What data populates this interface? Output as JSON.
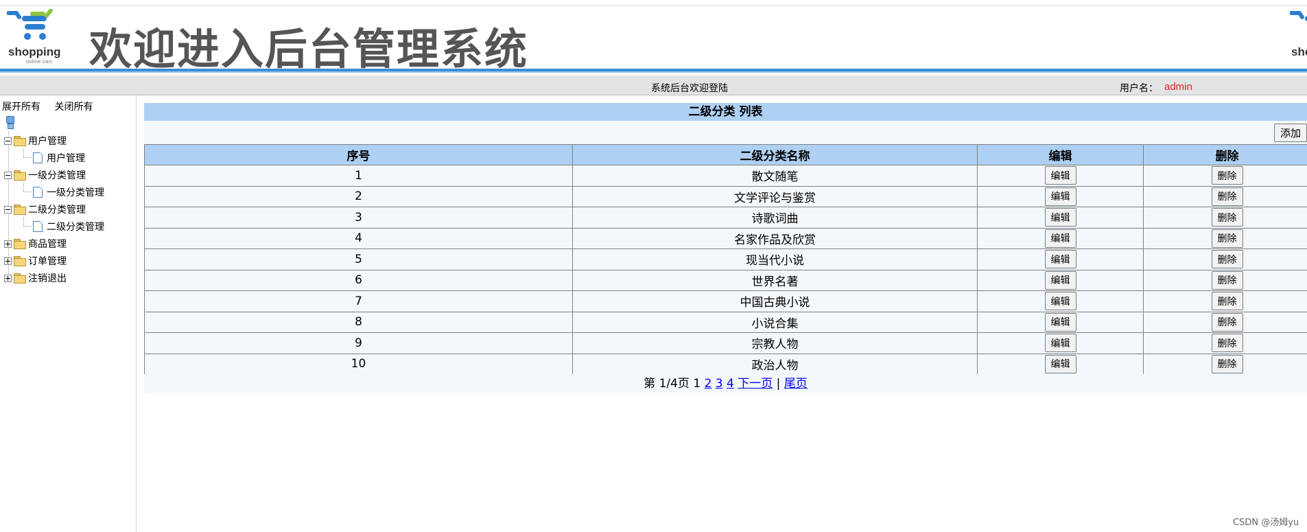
{
  "header": {
    "title": "欢迎进入后台管理系统",
    "logo_word": "shopping",
    "logo_sub": "online cart"
  },
  "status": {
    "welcome": "系统后台欢迎登陆",
    "user_label": "用户名：",
    "user_value": "admin"
  },
  "sidebar": {
    "expand_all": "展开所有",
    "collapse_all": "关闭所有",
    "items": [
      {
        "label": "用户管理",
        "type": "folder",
        "expanded": true
      },
      {
        "label": "用户管理",
        "type": "page"
      },
      {
        "label": "一级分类管理",
        "type": "folder",
        "expanded": true
      },
      {
        "label": "一级分类管理",
        "type": "page"
      },
      {
        "label": "二级分类管理",
        "type": "folder",
        "expanded": true
      },
      {
        "label": "二级分类管理",
        "type": "page"
      },
      {
        "label": "商品管理",
        "type": "folder",
        "expanded": false
      },
      {
        "label": "订单管理",
        "type": "folder",
        "expanded": false
      },
      {
        "label": "注销退出",
        "type": "folder",
        "expanded": false
      }
    ]
  },
  "list": {
    "title": "二级分类 列表",
    "add_label": "添加",
    "columns": [
      "序号",
      "二级分类名称",
      "编辑",
      "删除"
    ],
    "edit_label": "编辑",
    "delete_label": "删除",
    "rows": [
      {
        "id": "1",
        "name": "散文随笔"
      },
      {
        "id": "2",
        "name": "文学评论与鉴赏"
      },
      {
        "id": "3",
        "name": "诗歌词曲"
      },
      {
        "id": "4",
        "name": "名家作品及欣赏"
      },
      {
        "id": "5",
        "name": "现当代小说"
      },
      {
        "id": "6",
        "name": "世界名著"
      },
      {
        "id": "7",
        "name": "中国古典小说"
      },
      {
        "id": "8",
        "name": "小说合集"
      },
      {
        "id": "9",
        "name": "宗教人物"
      },
      {
        "id": "10",
        "name": "政治人物"
      }
    ]
  },
  "pager": {
    "info": "第 1/4页 1",
    "links": [
      "2",
      "3",
      "4"
    ],
    "next": "下一页",
    "separator": "|",
    "last": "尾页"
  },
  "watermark": "CSDN @汤姆yu",
  "colors": {
    "accent_band": "#3b8ed8",
    "table_header": "#aed0f3",
    "table_cell": "#f3f8fd",
    "username": "#e02020",
    "link": "#0000ee"
  }
}
